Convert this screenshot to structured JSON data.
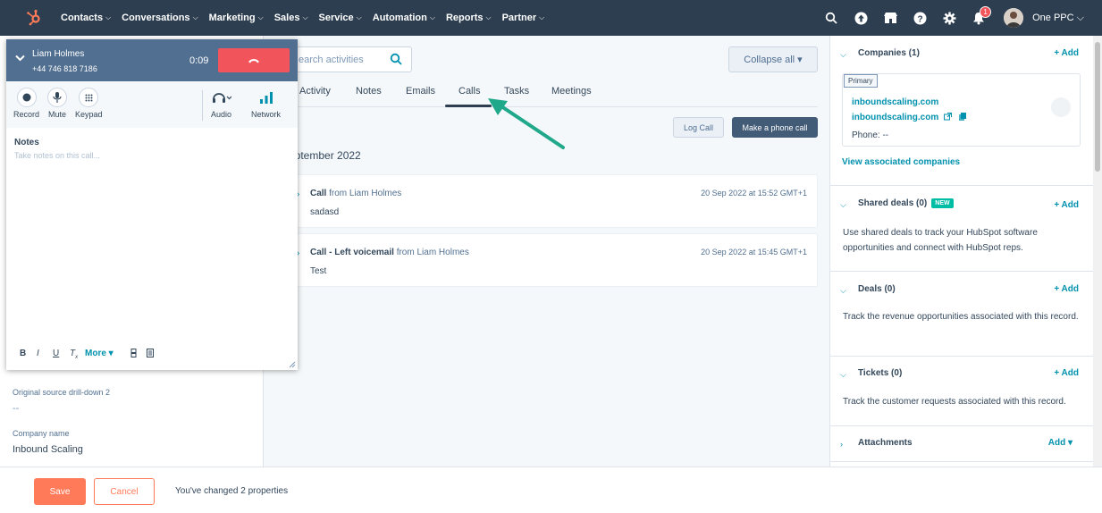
{
  "nav": {
    "items": [
      {
        "label": "Contacts",
        "caret": "⌵"
      },
      {
        "label": "Conversations",
        "caret": "⌵"
      },
      {
        "label": "Marketing",
        "caret": "⌵"
      },
      {
        "label": "Sales",
        "caret": "⌵"
      },
      {
        "label": "Service",
        "caret": "⌵"
      },
      {
        "label": "Automation",
        "caret": "⌵"
      },
      {
        "label": "Reports",
        "caret": "⌵"
      },
      {
        "label": "Partner",
        "caret": "⌵"
      }
    ],
    "notification_count": "1",
    "account_name": "One PPC ⌵"
  },
  "left_panel": {
    "props": [
      {
        "label": "Original source drill-down 2",
        "value": "--"
      },
      {
        "label": "Company name",
        "value": "Inbound Scaling"
      }
    ]
  },
  "timeline": {
    "search_placeholder": "earch activities",
    "collapse_label": "Collapse all ▾",
    "tabs": [
      "Activity",
      "Notes",
      "Emails",
      "Calls",
      "Tasks",
      "Meetings"
    ],
    "active_tab": "Calls",
    "log_call_label": "Log Call",
    "make_call_label": "Make a phone call",
    "month_label": "eptember 2022",
    "activities": [
      {
        "type": "Call",
        "from": "from Liam Holmes",
        "date": "20 Sep 2022 at 15:52 GMT+1",
        "body": "sadasd"
      },
      {
        "type": "Call - Left voicemail",
        "from": "from Liam Holmes",
        "date": "20 Sep 2022 at 15:45 GMT+1",
        "body": "Test"
      }
    ]
  },
  "sidebar": {
    "companies": {
      "title": "Companies (1)",
      "add": "+ Add",
      "primary_tag": "Primary",
      "name": "inboundscaling.com",
      "domain": "inboundscaling.com",
      "phone": "Phone: --",
      "view_link": "View associated companies"
    },
    "shared_deals": {
      "title": "Shared deals (0)",
      "badge": "NEW",
      "add": "+ Add",
      "text": "Use shared deals to track your HubSpot software opportunities and connect with HubSpot reps."
    },
    "deals": {
      "title": "Deals (0)",
      "add": "+ Add",
      "text": "Track the revenue opportunities associated with this record."
    },
    "tickets": {
      "title": "Tickets (0)",
      "add": "+ Add",
      "text": "Track the customer requests associated with this record."
    },
    "attachments": {
      "title": "Attachments",
      "add": "Add ▾"
    }
  },
  "bottom": {
    "save": "Save",
    "cancel": "Cancel",
    "changed": "You've changed 2 properties"
  },
  "call_widget": {
    "name": "Liam Holmes",
    "number": "+44 746 818 7186",
    "timer": "0:09",
    "controls": {
      "record": "Record",
      "mute": "Mute",
      "keypad": "Keypad",
      "audio": "Audio",
      "network": "Network"
    },
    "notes_label": "Notes",
    "notes_placeholder": "Take notes on this call...",
    "more_label": "More ▾"
  },
  "colors": {
    "nav_bg": "#2d3e50",
    "accent": "#0091ae",
    "hangup": "#f2545b",
    "save": "#ff7a59",
    "arrow": "#1fa88a"
  }
}
